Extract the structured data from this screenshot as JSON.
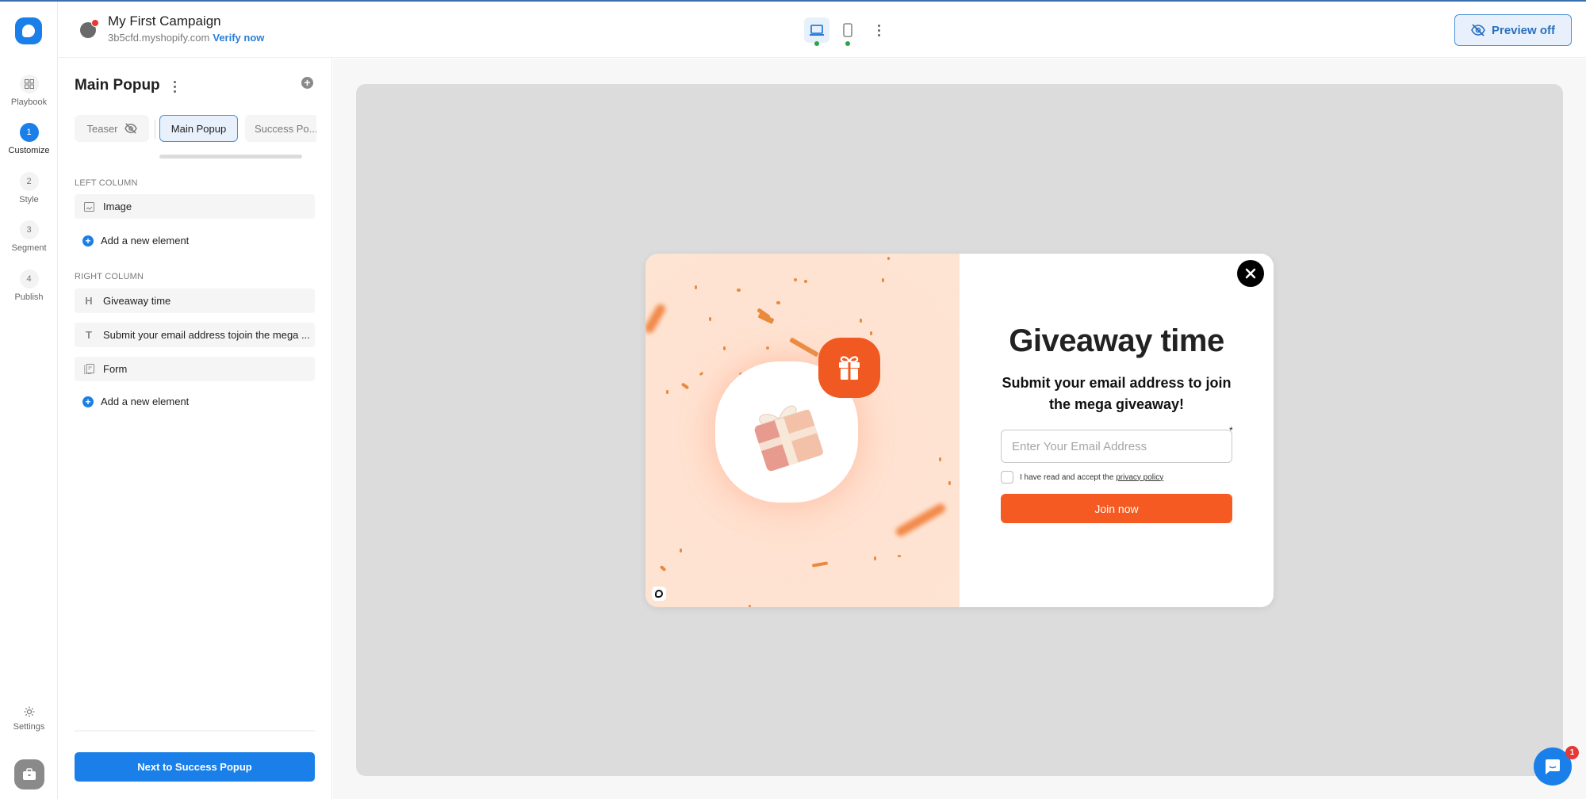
{
  "app": {
    "colors": {
      "brand": "#1a7fe8",
      "accent_orange": "#f55a22",
      "success_dot": "#27a745",
      "alert": "#e53935"
    }
  },
  "rail": {
    "items": [
      {
        "key": "playbook",
        "label": "Playbook",
        "bubble": "",
        "icon": "grid-icon",
        "active": false
      },
      {
        "key": "customize",
        "label": "Customize",
        "bubble": "1",
        "active": true
      },
      {
        "key": "style",
        "label": "Style",
        "bubble": "2",
        "active": false
      },
      {
        "key": "segment",
        "label": "Segment",
        "bubble": "3",
        "active": false
      },
      {
        "key": "publish",
        "label": "Publish",
        "bubble": "4",
        "active": false
      }
    ],
    "settings_label": "Settings"
  },
  "header": {
    "campaign_title": "My First Campaign",
    "domain": "3b5cfd.myshopify.com",
    "verify_label": "Verify now",
    "preview_label": "Preview off"
  },
  "panel": {
    "title": "Main Popup",
    "tabs": [
      {
        "label": "Teaser",
        "hidden": true
      },
      {
        "label": "Main Popup",
        "active": true
      },
      {
        "label": "Success Po..."
      }
    ],
    "left_column_label": "LEFT COLUMN",
    "left_elements": [
      {
        "type": "image",
        "label": "Image"
      }
    ],
    "right_column_label": "RIGHT COLUMN",
    "right_elements": [
      {
        "type": "heading",
        "icon_text": "H",
        "label": "Giveaway time"
      },
      {
        "type": "text",
        "icon_text": "T",
        "label": "Submit your email address tojoin the mega ..."
      },
      {
        "type": "form",
        "label": "Form"
      }
    ],
    "add_element_label": "Add a new element",
    "next_button_label": "Next to Success Popup"
  },
  "popup": {
    "heading": "Giveaway time",
    "subheading": "Submit your email address to join the mega giveaway!",
    "email_placeholder": "Enter Your Email Address",
    "required_mark": "*",
    "consent_text": "I have read and accept the",
    "privacy_link": "privacy policy",
    "join_label": "Join now"
  },
  "chat": {
    "unread_count": "1"
  }
}
